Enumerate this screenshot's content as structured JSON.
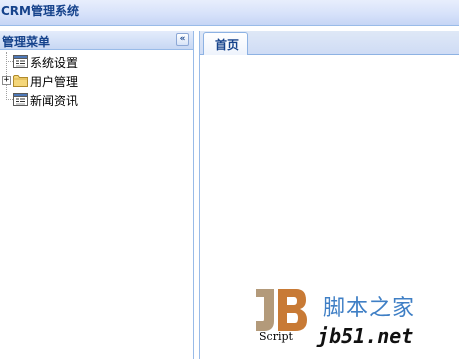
{
  "app": {
    "title": "CRM管理系统"
  },
  "west": {
    "title": "管理菜单",
    "collapse_glyph": "«",
    "tree": [
      {
        "label": "系统设置",
        "icon": "document-icon",
        "expandable": false
      },
      {
        "label": "用户管理",
        "icon": "folder-icon",
        "expandable": true,
        "expander_glyph": "+"
      },
      {
        "label": "新闻资讯",
        "icon": "document-icon",
        "expandable": false
      }
    ]
  },
  "tabs": [
    {
      "label": "首页",
      "active": true
    }
  ],
  "watermark": {
    "logo_text": "Script",
    "cn_text": "脚本之家",
    "site_text": "jb51.net"
  },
  "colors": {
    "header_text": "#15428b",
    "border": "#99bbe8",
    "watermark_blue": "#3f7fc5",
    "logo_orange": "#c87a35",
    "logo_tan": "#b39a7a"
  }
}
